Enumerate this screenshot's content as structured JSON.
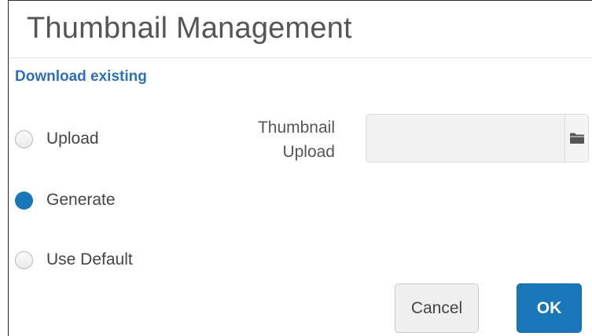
{
  "dialog": {
    "title": "Thumbnail Management",
    "download_link": "Download existing"
  },
  "options": [
    {
      "label": "Upload",
      "checked": false
    },
    {
      "label": "Generate",
      "checked": true
    },
    {
      "label": "Use Default",
      "checked": false
    }
  ],
  "upload_field": {
    "label_line1": "Thumbnail",
    "label_line2": "Upload",
    "value": "",
    "browse_icon": "folder-icon"
  },
  "buttons": {
    "cancel_label": "Cancel",
    "ok_label": "OK"
  },
  "colors": {
    "accent": "#1976b8",
    "link": "#2e6fb7",
    "text": "#555555"
  }
}
